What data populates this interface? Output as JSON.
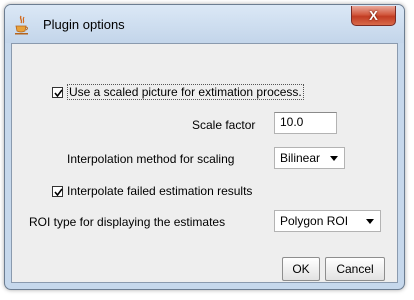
{
  "window": {
    "title": "Plugin options",
    "close_label": "X",
    "title_icon": "java-coffee-cup-icon"
  },
  "options": {
    "use_scaled": {
      "label": "Use a scaled picture for extimation process.",
      "checked": true
    },
    "scale_factor": {
      "label": "Scale factor",
      "value": "10.0"
    },
    "interpolation": {
      "label": "Interpolation method for scaling",
      "selected": "Bilinear"
    },
    "interpolate_failed": {
      "label": "Interpolate failed estimation results",
      "checked": true
    },
    "roi_type": {
      "label": "ROI type for displaying the estimates",
      "selected": "Polygon ROI"
    }
  },
  "buttons": {
    "ok": "OK",
    "cancel": "Cancel"
  },
  "colors": {
    "frame": "#c6d8ec",
    "client": "#eeeeee",
    "close": "#c23c23"
  }
}
